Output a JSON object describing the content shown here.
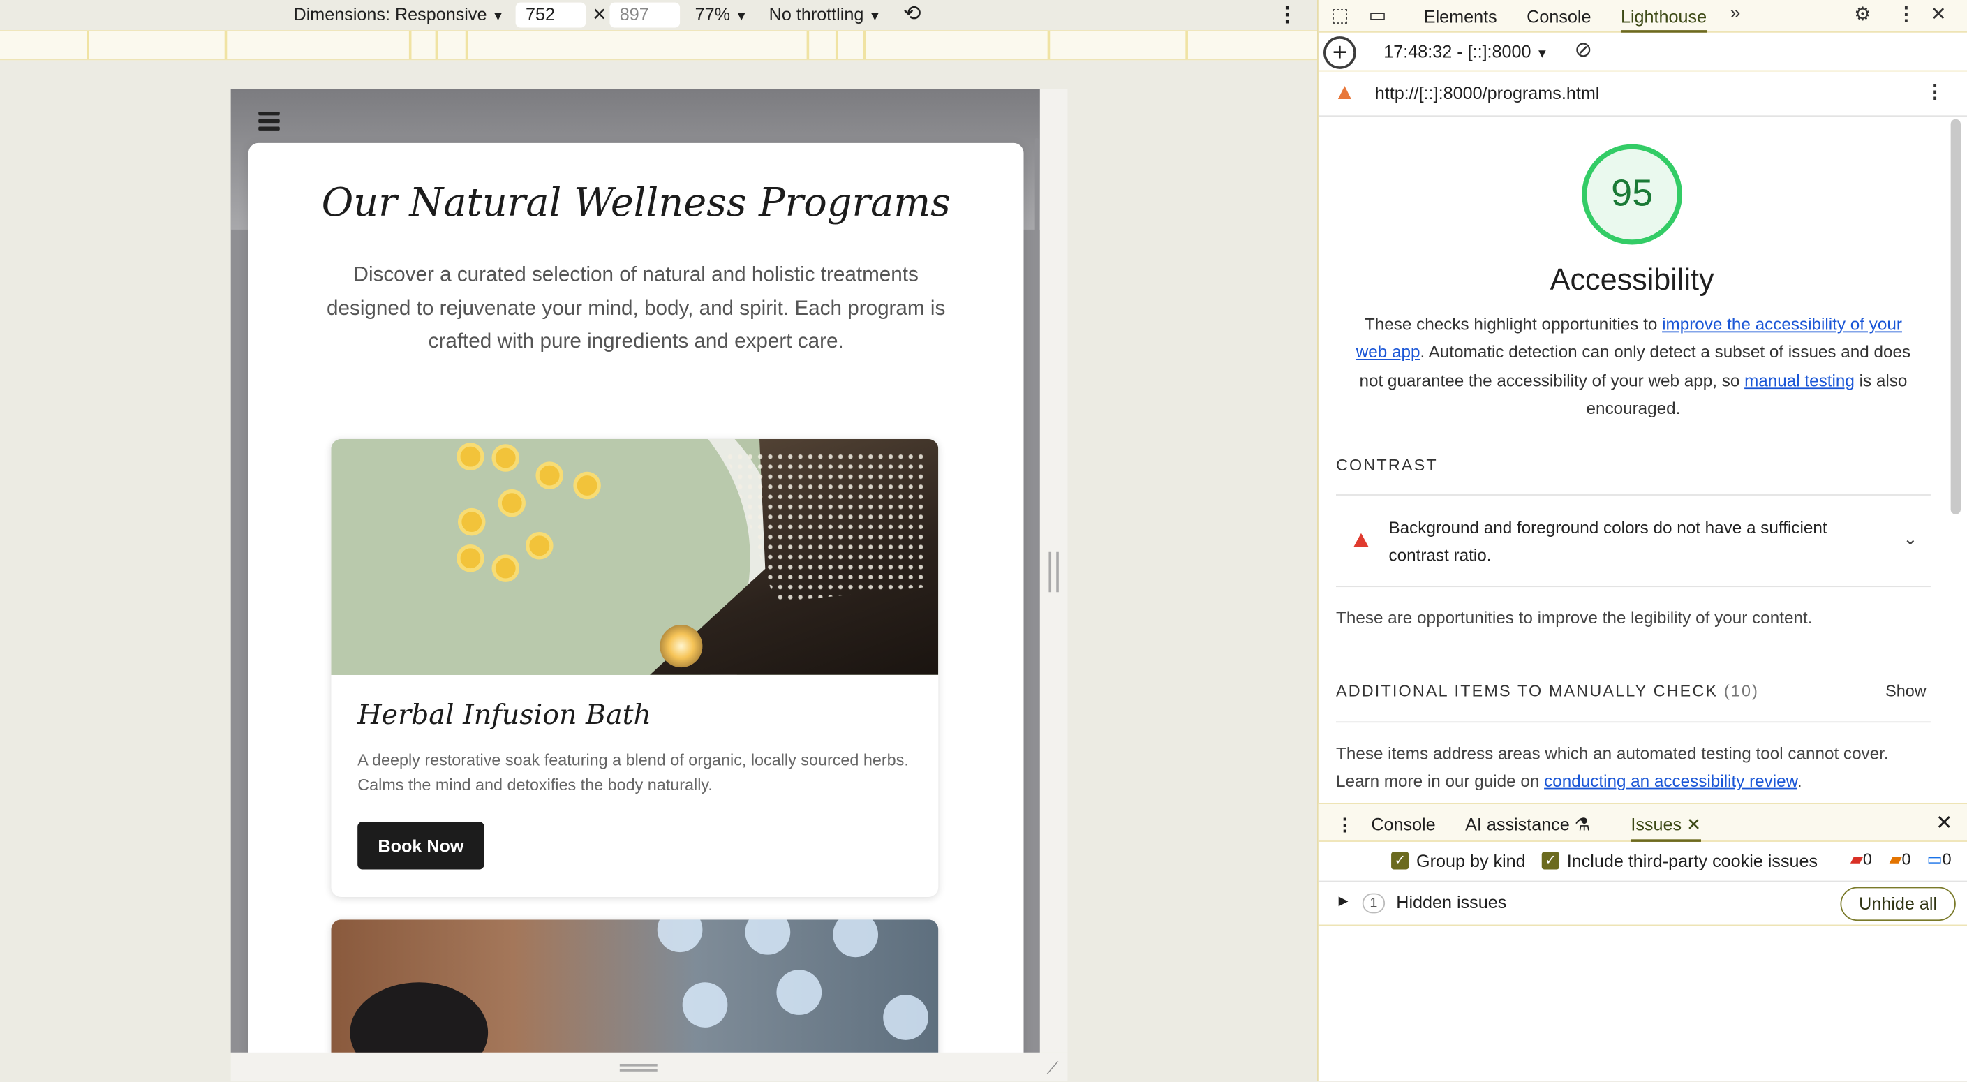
{
  "device_toolbar": {
    "dimensions_label": "Dimensions: Responsive",
    "width": "752",
    "height": "897",
    "zoom": "77%",
    "throttling": "No throttling"
  },
  "page": {
    "title": "Our Natural Wellness Programs",
    "intro": "Discover a curated selection of natural and holistic treatments designed to rejuvenate your mind, body, and spirit. Each program is crafted with pure ingredients and expert care.",
    "programs": [
      {
        "title": "Herbal Infusion Bath",
        "description": "A deeply restorative soak featuring a blend of organic, locally sourced herbs. Calms the mind and detoxifies the body naturally.",
        "button": "Book Now"
      }
    ]
  },
  "devtools": {
    "tabs": [
      "Elements",
      "Console",
      "Lighthouse"
    ],
    "active_tab": "Lighthouse",
    "report_time": "17:48:32 - [::]:8000",
    "url": "http://[::]:8000/programs.html",
    "score": "95",
    "category": "Accessibility",
    "desc_part1": "These checks highlight opportunities to ",
    "desc_link1": "improve the accessibility of your web app",
    "desc_part2": ". Automatic detection can only detect a subset of issues and does not guarantee the accessibility of your web app, so ",
    "desc_link2": "manual testing",
    "desc_part3": " is also encouraged.",
    "contrast_heading": "CONTRAST",
    "contrast_audit": "Background and foreground colors do not have a sufficient contrast ratio.",
    "contrast_note": "These are opportunities to improve the legibility of your content.",
    "manual_heading": "ADDITIONAL ITEMS TO MANUALLY CHECK",
    "manual_count": "(10)",
    "show_label": "Show",
    "manual_note_part1": "These items address areas which an automated testing tool cannot cover. Learn more in our guide on ",
    "manual_note_link": "conducting an accessibility review",
    "manual_note_part2": ".",
    "score_color": "#33cc66",
    "audit_fail_color": "#e03b2f"
  },
  "drawer": {
    "tabs": [
      "Console",
      "AI assistance",
      "Issues"
    ],
    "active_tab": "Issues",
    "group_by_kind": "Group by kind",
    "third_party": "Include third-party cookie issues",
    "error_count": "0",
    "warning_count": "0",
    "info_count": "0",
    "hidden_count": "1",
    "hidden_issues": "Hidden issues",
    "unhide_all": "Unhide all"
  }
}
